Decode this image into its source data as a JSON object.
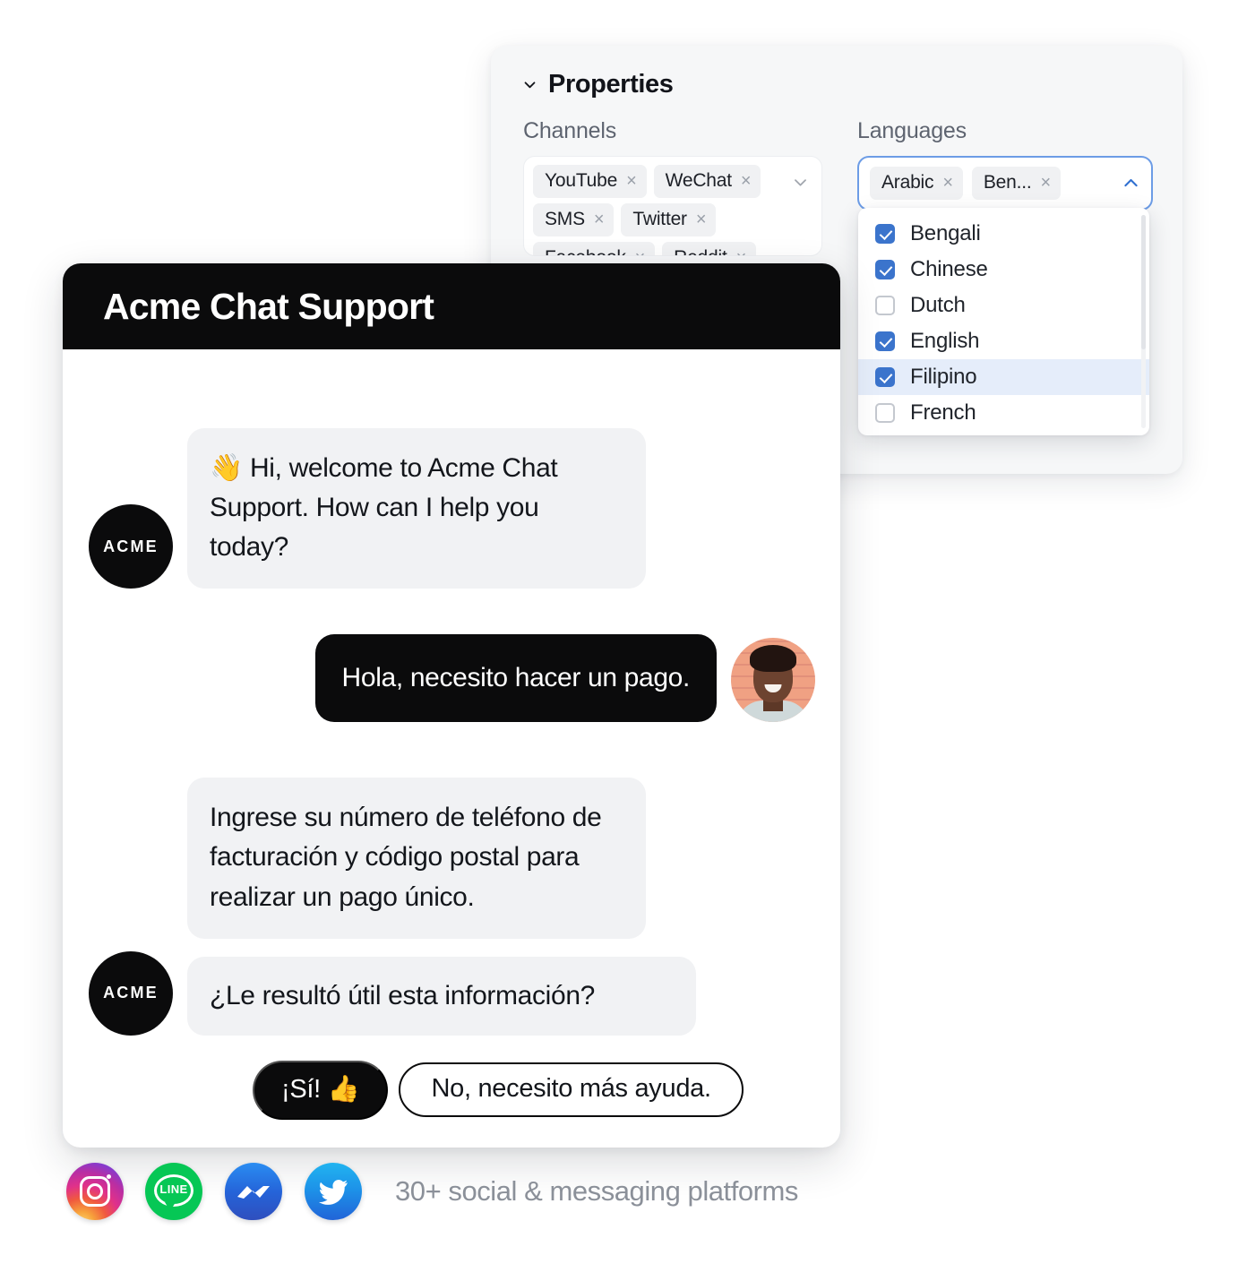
{
  "properties_panel": {
    "header": {
      "title": "Properties",
      "collapse_icon": "chevron-down-icon"
    },
    "channels": {
      "label": "Channels",
      "caret_icon": "chevron-down-icon",
      "chips": [
        {
          "label": "YouTube",
          "remove": "×"
        },
        {
          "label": "WeChat",
          "remove": "×"
        },
        {
          "label": "SMS",
          "remove": "×"
        },
        {
          "label": "Twitter",
          "remove": "×"
        },
        {
          "label": "Facebook",
          "remove": "×"
        },
        {
          "label": "Reddit",
          "remove": "×"
        }
      ]
    },
    "languages": {
      "label": "Languages",
      "caret_icon": "chevron-up-icon",
      "chips": [
        {
          "label": "Arabic",
          "remove": "×"
        },
        {
          "label": "Ben...",
          "remove": "×"
        }
      ],
      "dropdown_options": [
        {
          "label": "Bengali",
          "checked": true,
          "highlighted": false
        },
        {
          "label": "Chinese",
          "checked": true,
          "highlighted": false
        },
        {
          "label": "Dutch",
          "checked": false,
          "highlighted": false
        },
        {
          "label": "English",
          "checked": true,
          "highlighted": false
        },
        {
          "label": "Filipino",
          "checked": true,
          "highlighted": true
        },
        {
          "label": "French",
          "checked": false,
          "highlighted": false
        }
      ]
    },
    "colors": {
      "panel_bg": "#f6f7f8",
      "focus_border": "#6c9ce6",
      "checkbox_on": "#3b74cc",
      "highlight_row": "#e5edfa"
    }
  },
  "chat_widget": {
    "title": "Acme Chat Support",
    "bot_avatar_label": "ACME",
    "messages": [
      {
        "from": "bot",
        "text": "👋 Hi, welcome to Acme Chat Support. How can I help you today?"
      },
      {
        "from": "user",
        "text": "Hola, necesito hacer un pago."
      },
      {
        "from": "bot",
        "text": "Ingrese su número de teléfono de facturación y código postal para realizar un pago único."
      },
      {
        "from": "bot",
        "text": "¿Le resultó útil esta información?"
      }
    ],
    "quick_replies": [
      {
        "label": "¡Sí! 👍",
        "style": "primary"
      },
      {
        "label": "No, necesito más ayuda.",
        "style": "secondary"
      }
    ],
    "colors": {
      "header_bg": "#0b0b0c",
      "bot_bubble_bg": "#f1f2f4",
      "user_bubble_bg": "#0b0b0c"
    }
  },
  "footer": {
    "caption": "30+ social & messaging platforms",
    "social_icons": [
      {
        "name": "instagram-icon",
        "color": "#e0318a"
      },
      {
        "name": "line-icon",
        "color": "#06c755",
        "wordmark": "LINE"
      },
      {
        "name": "messenger-icon",
        "color": "#2563d8"
      },
      {
        "name": "twitter-icon",
        "color": "#1d91e8"
      }
    ]
  }
}
